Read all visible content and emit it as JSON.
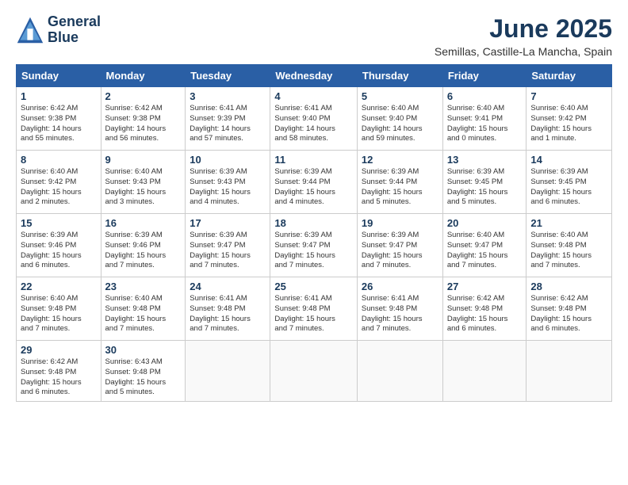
{
  "logo": {
    "line1": "General",
    "line2": "Blue"
  },
  "title": "June 2025",
  "location": "Semillas, Castille-La Mancha, Spain",
  "days_of_week": [
    "Sunday",
    "Monday",
    "Tuesday",
    "Wednesday",
    "Thursday",
    "Friday",
    "Saturday"
  ],
  "weeks": [
    [
      {
        "day": "1",
        "info": "Sunrise: 6:42 AM\nSunset: 9:38 PM\nDaylight: 14 hours\nand 55 minutes."
      },
      {
        "day": "2",
        "info": "Sunrise: 6:42 AM\nSunset: 9:38 PM\nDaylight: 14 hours\nand 56 minutes."
      },
      {
        "day": "3",
        "info": "Sunrise: 6:41 AM\nSunset: 9:39 PM\nDaylight: 14 hours\nand 57 minutes."
      },
      {
        "day": "4",
        "info": "Sunrise: 6:41 AM\nSunset: 9:40 PM\nDaylight: 14 hours\nand 58 minutes."
      },
      {
        "day": "5",
        "info": "Sunrise: 6:40 AM\nSunset: 9:40 PM\nDaylight: 14 hours\nand 59 minutes."
      },
      {
        "day": "6",
        "info": "Sunrise: 6:40 AM\nSunset: 9:41 PM\nDaylight: 15 hours\nand 0 minutes."
      },
      {
        "day": "7",
        "info": "Sunrise: 6:40 AM\nSunset: 9:42 PM\nDaylight: 15 hours\nand 1 minute."
      }
    ],
    [
      {
        "day": "8",
        "info": "Sunrise: 6:40 AM\nSunset: 9:42 PM\nDaylight: 15 hours\nand 2 minutes."
      },
      {
        "day": "9",
        "info": "Sunrise: 6:40 AM\nSunset: 9:43 PM\nDaylight: 15 hours\nand 3 minutes."
      },
      {
        "day": "10",
        "info": "Sunrise: 6:39 AM\nSunset: 9:43 PM\nDaylight: 15 hours\nand 4 minutes."
      },
      {
        "day": "11",
        "info": "Sunrise: 6:39 AM\nSunset: 9:44 PM\nDaylight: 15 hours\nand 4 minutes."
      },
      {
        "day": "12",
        "info": "Sunrise: 6:39 AM\nSunset: 9:44 PM\nDaylight: 15 hours\nand 5 minutes."
      },
      {
        "day": "13",
        "info": "Sunrise: 6:39 AM\nSunset: 9:45 PM\nDaylight: 15 hours\nand 5 minutes."
      },
      {
        "day": "14",
        "info": "Sunrise: 6:39 AM\nSunset: 9:45 PM\nDaylight: 15 hours\nand 6 minutes."
      }
    ],
    [
      {
        "day": "15",
        "info": "Sunrise: 6:39 AM\nSunset: 9:46 PM\nDaylight: 15 hours\nand 6 minutes."
      },
      {
        "day": "16",
        "info": "Sunrise: 6:39 AM\nSunset: 9:46 PM\nDaylight: 15 hours\nand 7 minutes."
      },
      {
        "day": "17",
        "info": "Sunrise: 6:39 AM\nSunset: 9:47 PM\nDaylight: 15 hours\nand 7 minutes."
      },
      {
        "day": "18",
        "info": "Sunrise: 6:39 AM\nSunset: 9:47 PM\nDaylight: 15 hours\nand 7 minutes."
      },
      {
        "day": "19",
        "info": "Sunrise: 6:39 AM\nSunset: 9:47 PM\nDaylight: 15 hours\nand 7 minutes."
      },
      {
        "day": "20",
        "info": "Sunrise: 6:40 AM\nSunset: 9:47 PM\nDaylight: 15 hours\nand 7 minutes."
      },
      {
        "day": "21",
        "info": "Sunrise: 6:40 AM\nSunset: 9:48 PM\nDaylight: 15 hours\nand 7 minutes."
      }
    ],
    [
      {
        "day": "22",
        "info": "Sunrise: 6:40 AM\nSunset: 9:48 PM\nDaylight: 15 hours\nand 7 minutes."
      },
      {
        "day": "23",
        "info": "Sunrise: 6:40 AM\nSunset: 9:48 PM\nDaylight: 15 hours\nand 7 minutes."
      },
      {
        "day": "24",
        "info": "Sunrise: 6:41 AM\nSunset: 9:48 PM\nDaylight: 15 hours\nand 7 minutes."
      },
      {
        "day": "25",
        "info": "Sunrise: 6:41 AM\nSunset: 9:48 PM\nDaylight: 15 hours\nand 7 minutes."
      },
      {
        "day": "26",
        "info": "Sunrise: 6:41 AM\nSunset: 9:48 PM\nDaylight: 15 hours\nand 7 minutes."
      },
      {
        "day": "27",
        "info": "Sunrise: 6:42 AM\nSunset: 9:48 PM\nDaylight: 15 hours\nand 6 minutes."
      },
      {
        "day": "28",
        "info": "Sunrise: 6:42 AM\nSunset: 9:48 PM\nDaylight: 15 hours\nand 6 minutes."
      }
    ],
    [
      {
        "day": "29",
        "info": "Sunrise: 6:42 AM\nSunset: 9:48 PM\nDaylight: 15 hours\nand 6 minutes."
      },
      {
        "day": "30",
        "info": "Sunrise: 6:43 AM\nSunset: 9:48 PM\nDaylight: 15 hours\nand 5 minutes."
      },
      {
        "day": "",
        "info": ""
      },
      {
        "day": "",
        "info": ""
      },
      {
        "day": "",
        "info": ""
      },
      {
        "day": "",
        "info": ""
      },
      {
        "day": "",
        "info": ""
      }
    ]
  ]
}
